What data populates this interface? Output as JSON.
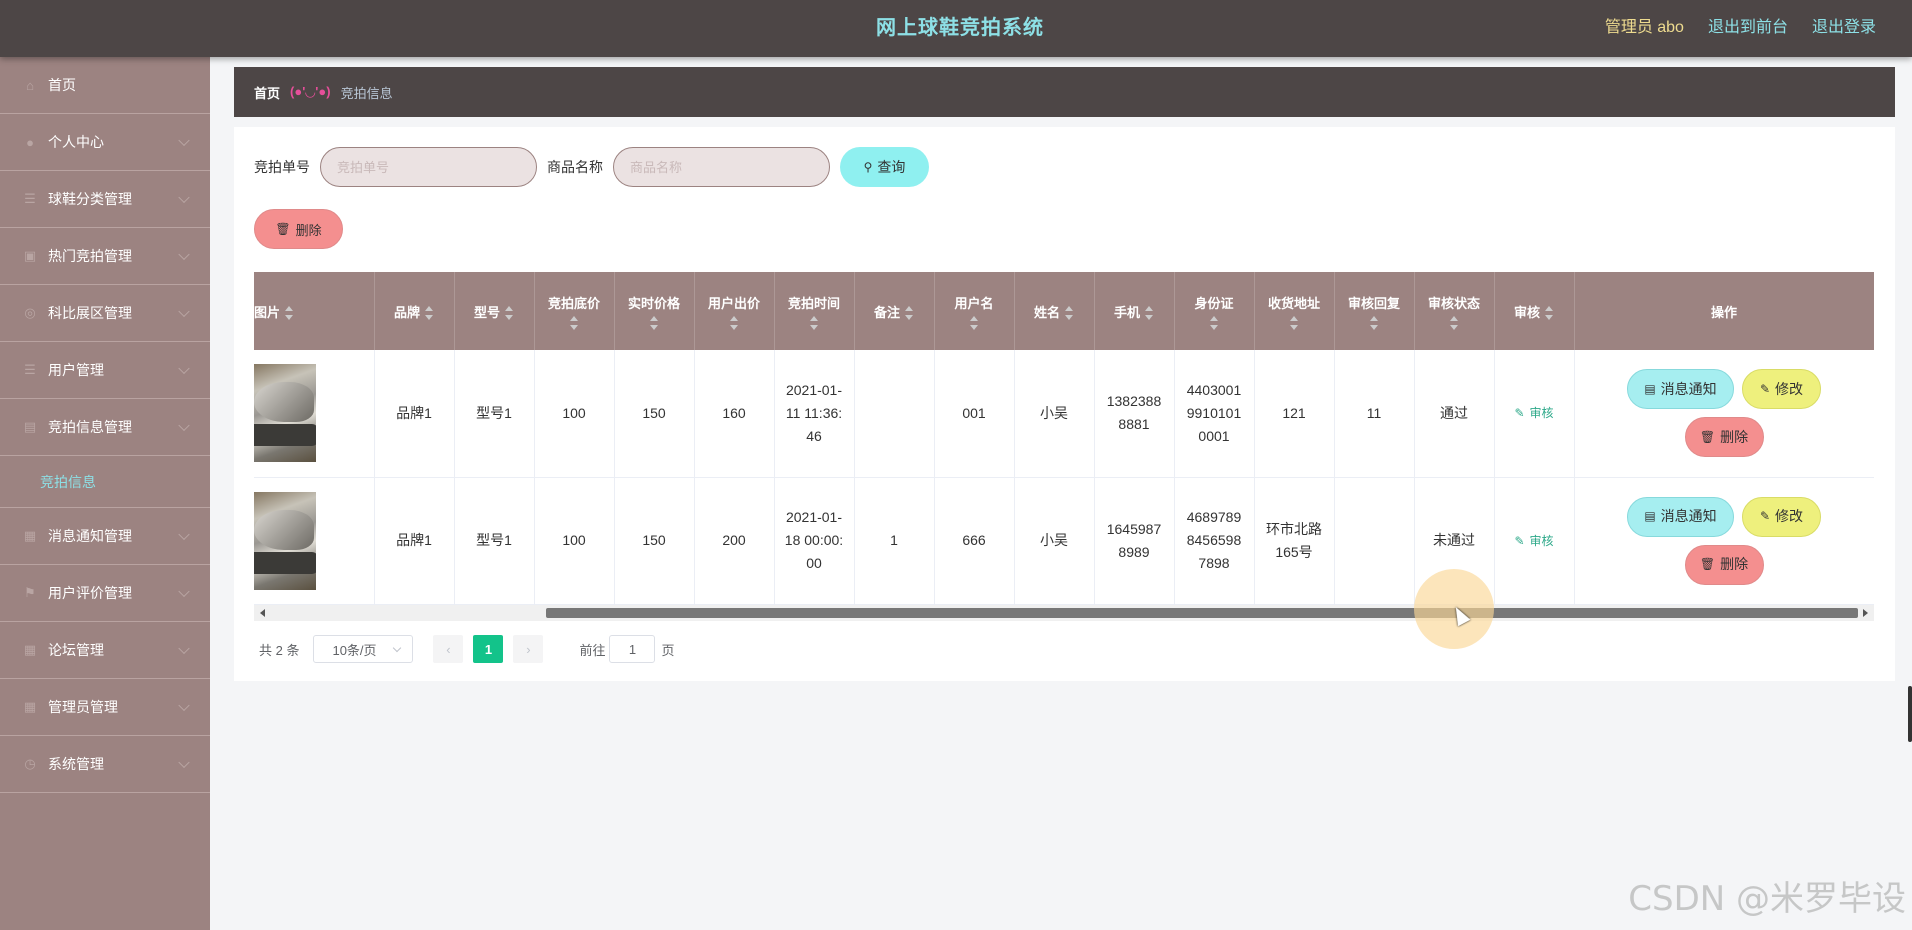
{
  "header": {
    "title": "网上球鞋竞拍系统",
    "admin_label": "管理员 abo",
    "back_front": "退出到前台",
    "logout": "退出登录"
  },
  "sidebar": {
    "items": [
      {
        "label": "首页",
        "icon": "home-icon"
      },
      {
        "label": "个人中心",
        "icon": "user-icon"
      },
      {
        "label": "球鞋分类管理",
        "icon": "list-icon"
      },
      {
        "label": "热门竞拍管理",
        "icon": "image-icon"
      },
      {
        "label": "科比展区管理",
        "icon": "compass-icon"
      },
      {
        "label": "用户管理",
        "icon": "list-icon"
      },
      {
        "label": "竞拍信息管理",
        "icon": "document-icon"
      },
      {
        "label": "消息通知管理",
        "icon": "calendar-icon"
      },
      {
        "label": "用户评价管理",
        "icon": "flag-icon"
      },
      {
        "label": "论坛管理",
        "icon": "calendar-icon"
      },
      {
        "label": "管理员管理",
        "icon": "calendar-icon"
      },
      {
        "label": "系统管理",
        "icon": "clock-icon"
      }
    ],
    "active_sub": "竞拍信息"
  },
  "breadcrumb": {
    "home": "首页",
    "separator": "(●'◡'●)",
    "current": "竞拍信息"
  },
  "search": {
    "field1_label": "竞拍单号",
    "field1_placeholder": "竞拍单号",
    "field2_label": "商品名称",
    "field2_placeholder": "商品名称",
    "query_button": "查询"
  },
  "toolbar": {
    "delete_label": "删除"
  },
  "table": {
    "headers": {
      "image": "图片",
      "brand": "品牌",
      "model": "型号",
      "start_price": "竞拍底价",
      "live_price": "实时价格",
      "bid_price": "用户出价",
      "bid_time": "竞拍时间",
      "remark": "备注",
      "username": "用户名",
      "name": "姓名",
      "phone": "手机",
      "idcard": "身份证",
      "address": "收货地址",
      "audit_reply": "审核回复",
      "audit_status": "审核状态",
      "audit": "审核",
      "ops": "操作"
    },
    "rows": [
      {
        "brand": "品牌1",
        "model": "型号1",
        "start_price": "100",
        "live_price": "150",
        "bid_price": "160",
        "bid_time": "2021-01-11 11:36:46",
        "remark": "",
        "username": "001",
        "name": "小吴",
        "phone": "13823888881",
        "idcard": "440300199101010001",
        "address": "121",
        "audit_reply": "11",
        "audit_status": "通过",
        "audit_link": "审核",
        "btn_notice": "消息通知",
        "btn_edit": "修改",
        "btn_delete": "删除"
      },
      {
        "brand": "品牌1",
        "model": "型号1",
        "start_price": "100",
        "live_price": "150",
        "bid_price": "200",
        "bid_time": "2021-01-18 00:00:00",
        "remark": "1",
        "username": "666",
        "name": "小吴",
        "phone": "16459878989",
        "idcard": "468978984565987898",
        "address": "环市北路165号",
        "audit_reply": "",
        "audit_status": "未通过",
        "audit_link": "审核",
        "btn_notice": "消息通知",
        "btn_edit": "修改",
        "btn_delete": "删除"
      }
    ]
  },
  "pagination": {
    "total": "共 2 条",
    "page_size": "10条/页",
    "current_page": "1",
    "goto_label": "前往",
    "goto_value": "1",
    "page_suffix": "页"
  },
  "watermark": "CSDN @米罗毕设"
}
